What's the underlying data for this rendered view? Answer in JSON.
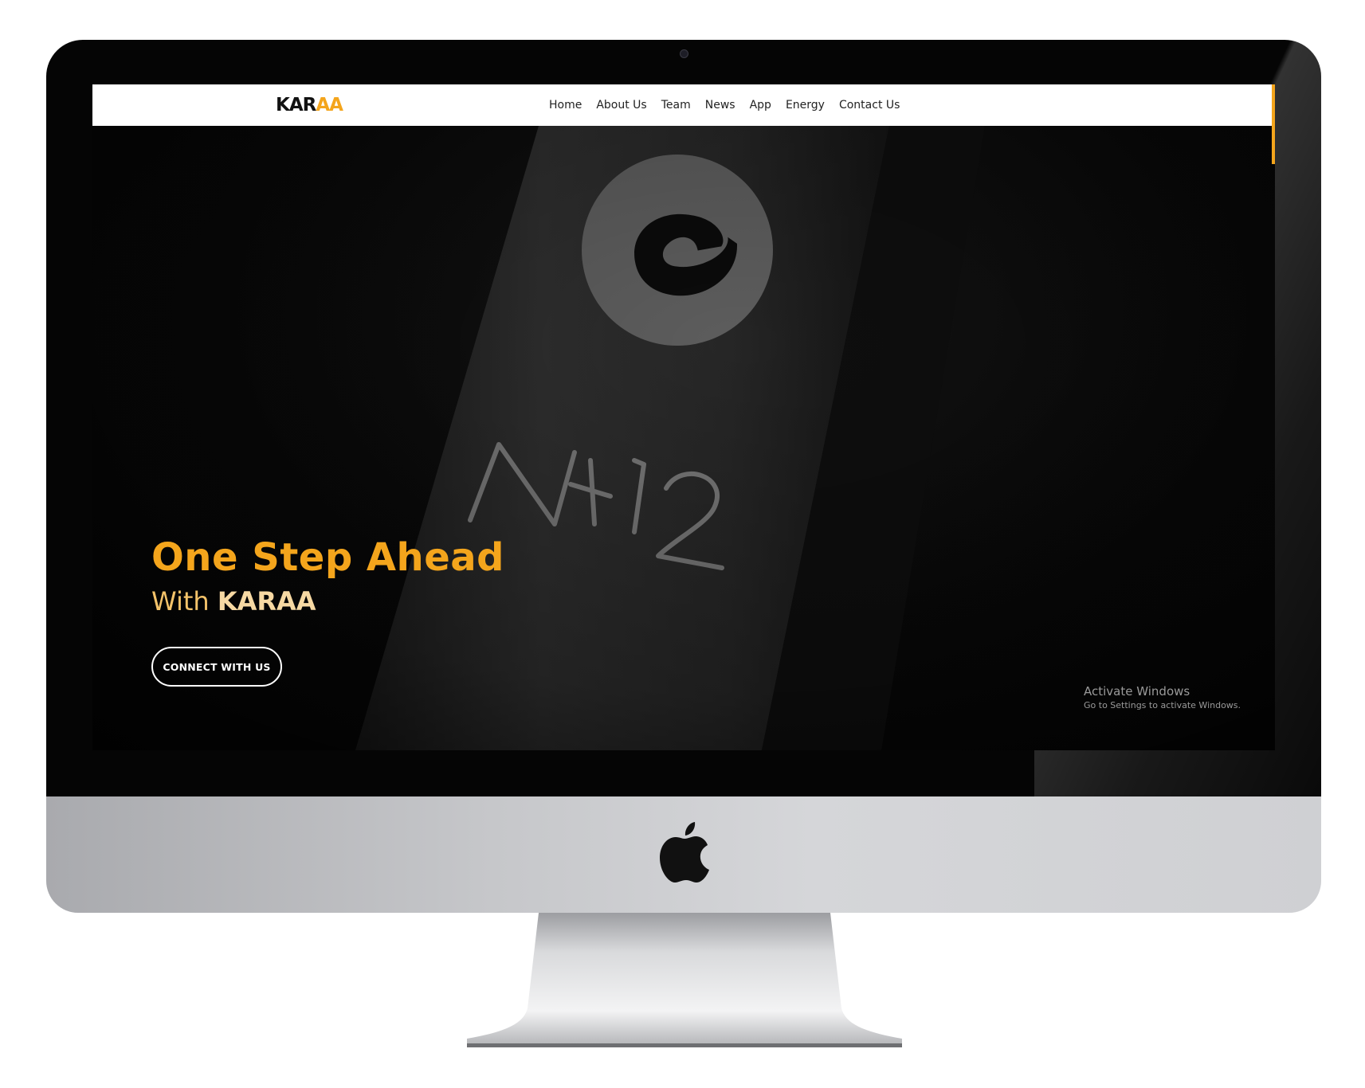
{
  "site": {
    "logo_text_dark": "KAR",
    "logo_text_accent": "AA"
  },
  "nav": {
    "items": [
      "Home",
      "About Us",
      "Team",
      "News",
      "App",
      "Energy",
      "Contact Us"
    ]
  },
  "hero": {
    "headline": "One Step Ahead",
    "subline_prefix": "With ",
    "subline_brand": "KARAA",
    "cta_label": "CONNECT WITH US",
    "product_marking": "NX12"
  },
  "watermark": {
    "title": "Activate Windows",
    "subtitle": "Go to Settings to activate Windows."
  },
  "colors": {
    "accent": "#f4a51c",
    "bezel": "#050505",
    "chin": "#c6c7ca"
  },
  "icons": {
    "hardware_logo": "apple-logo-icon",
    "product_logo": "circle-swirl-icon"
  }
}
